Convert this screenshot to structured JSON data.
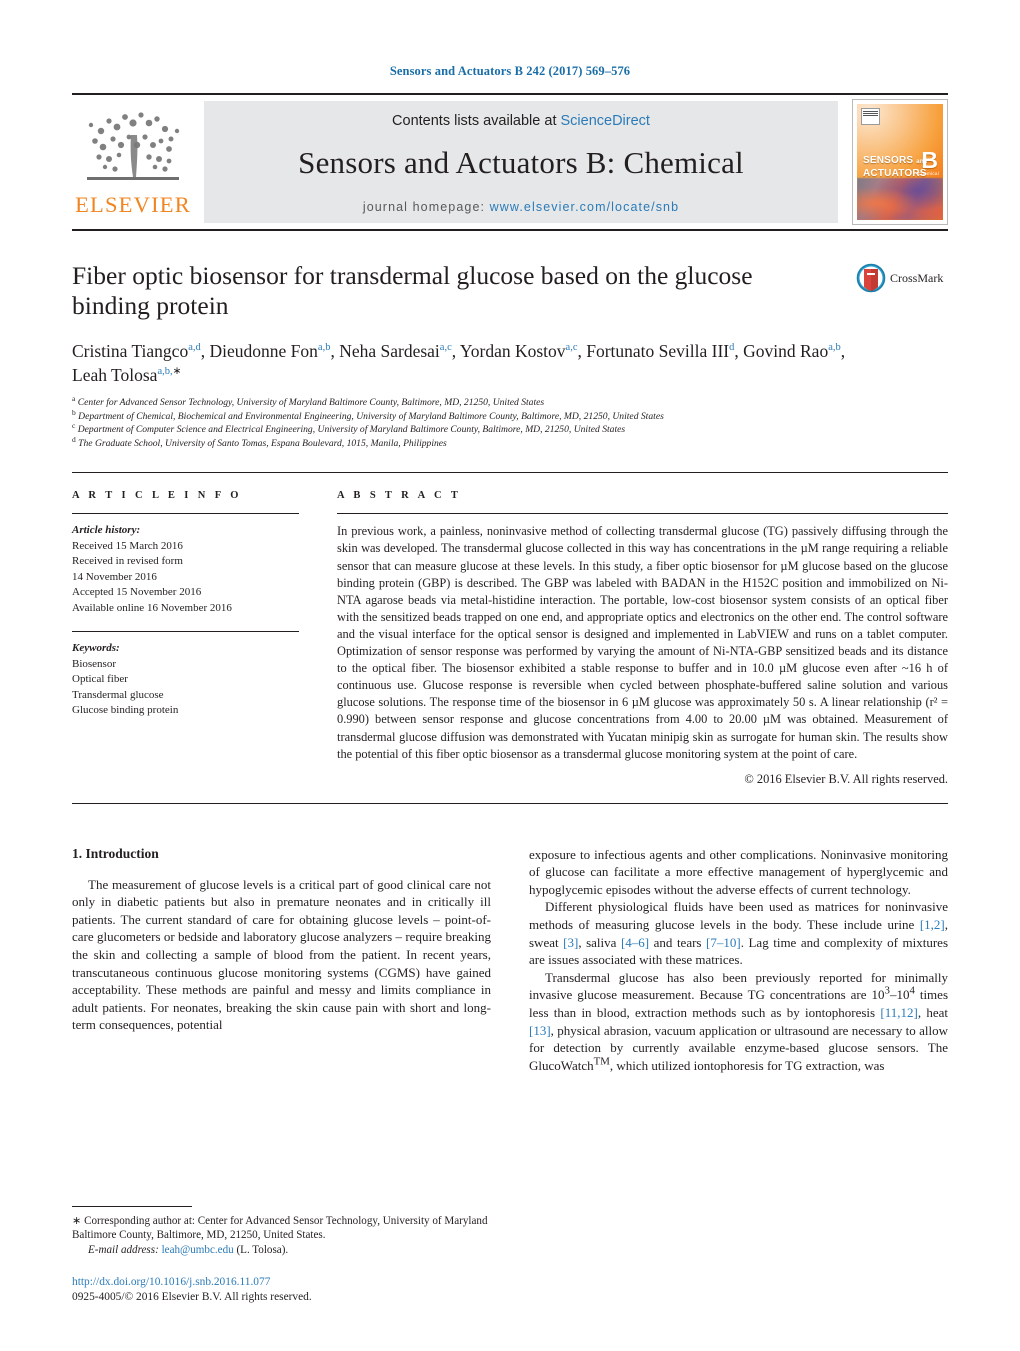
{
  "running_head": "Sensors and Actuators B 242 (2017) 569–576",
  "masthead": {
    "publisher_logo_text": "ELSEVIER",
    "contents_prefix": "Contents lists available at ",
    "contents_link": "ScienceDirect",
    "journal_title": "Sensors and Actuators B: Chemical",
    "homepage_prefix": "journal homepage: ",
    "homepage_url": "www.elsevier.com/locate/snb",
    "cover": {
      "line1": "SENSORS",
      "line1_suffix": "and",
      "line2": "ACTUATORS",
      "volume_letter": "B",
      "volume_sub": "Chemical"
    }
  },
  "article": {
    "title": "Fiber optic biosensor for transdermal glucose based on the glucose binding protein",
    "crossmark_label": "CrossMark",
    "authors": [
      {
        "name": "Cristina Tiangco",
        "marks": "a,d",
        "sep": ", "
      },
      {
        "name": "Dieudonne Fon",
        "marks": "a,b",
        "sep": ", "
      },
      {
        "name": "Neha Sardesai",
        "marks": "a,c",
        "sep": ", "
      },
      {
        "name": "Yordan Kostov",
        "marks": "a,c",
        "sep": ", "
      },
      {
        "name": "Fortunato Sevilla III",
        "marks": "d",
        "sep": ", "
      },
      {
        "name": "Govind Rao",
        "marks": "a,b",
        "sep": ", "
      },
      {
        "name": "Leah Tolosa",
        "marks": "a,b,",
        "star": "∗",
        "sep": ""
      }
    ],
    "affiliations": [
      {
        "mark": "a",
        "text": "Center for Advanced Sensor Technology, University of Maryland Baltimore County, Baltimore, MD, 21250, United States"
      },
      {
        "mark": "b",
        "text": "Department of Chemical, Biochemical and Environmental Engineering, University of Maryland Baltimore County, Baltimore, MD, 21250, United States"
      },
      {
        "mark": "c",
        "text": "Department of Computer Science and Electrical Engineering, University of Maryland Baltimore County, Baltimore, MD, 21250, United States"
      },
      {
        "mark": "d",
        "text": "The Graduate School, University of Santo Tomas, Espana Boulevard, 1015, Manila, Philippines"
      }
    ]
  },
  "article_info": {
    "kicker": "A R T I C L E   I N F O",
    "history_label": "Article history:",
    "history": [
      "Received 15 March 2016",
      "Received in revised form",
      "14 November 2016",
      "Accepted 15 November 2016",
      "Available online 16 November 2016"
    ],
    "keywords_label": "Keywords:",
    "keywords": [
      "Biosensor",
      "Optical fiber",
      "Transdermal glucose",
      "Glucose binding protein"
    ]
  },
  "abstract": {
    "kicker": "A B S T R A C T",
    "text": "In previous work, a painless, noninvasive method of collecting transdermal glucose (TG) passively diffusing through the skin was developed. The transdermal glucose collected in this way has concentrations in the µM range requiring a reliable sensor that can measure glucose at these levels. In this study, a fiber optic biosensor for µM glucose based on the glucose binding protein (GBP) is described. The GBP was labeled with BADAN in the H152C position and immobilized on Ni-NTA agarose beads via metal-histidine interaction. The portable, low-cost biosensor system consists of an optical fiber with the sensitized beads trapped on one end, and appropriate optics and electronics on the other end. The control software and the visual interface for the optical sensor is designed and implemented in LabVIEW and runs on a tablet computer. Optimization of sensor response was performed by varying the amount of Ni-NTA-GBP sensitized beads and its distance to the optical fiber. The biosensor exhibited a stable response to buffer and in 10.0 µM glucose even after ~16 h of continuous use. Glucose response is reversible when cycled between phosphate-buffered saline solution and various glucose solutions. The response time of the biosensor in 6 µM glucose was approximately 50 s. A linear relationship (r² = 0.990) between sensor response and glucose concentrations from 4.00 to 20.00 µM was obtained. Measurement of transdermal glucose diffusion was demonstrated with Yucatan minipig skin as surrogate for human skin. The results show the potential of this fiber optic biosensor as a transdermal glucose monitoring system at the point of care.",
    "copyright": "© 2016 Elsevier B.V. All rights reserved."
  },
  "body": {
    "section_number_title": "1.  Introduction",
    "left_paragraphs": [
      "The measurement of glucose levels is a critical part of good clinical care not only in diabetic patients but also in premature neonates and in critically ill patients. The current standard of care for obtaining glucose levels – point-of-care glucometers or bedside and laboratory glucose analyzers – require breaking the skin and collecting a sample of blood from the patient. In recent years, transcutaneous continuous glucose monitoring systems (CGMS) have gained acceptability. These methods are painful and messy and limits compliance in adult patients. For neonates, breaking the skin cause pain with short and long-term consequences, potential"
    ],
    "right_paragraphs": [
      {
        "segments": [
          {
            "t": "exposure to infectious agents and other complications. Noninvasive monitoring of glucose can facilitate a more effective management of hyperglycemic and hypoglycemic episodes without the adverse effects of current technology."
          }
        ],
        "indent": false
      },
      {
        "segments": [
          {
            "t": "Different physiological fluids have been used as matrices for noninvasive methods of measuring glucose levels in the body. These include urine "
          },
          {
            "t": "[1,2]",
            "link": true
          },
          {
            "t": ", sweat "
          },
          {
            "t": "[3]",
            "link": true
          },
          {
            "t": ", saliva "
          },
          {
            "t": "[4–6]",
            "link": true
          },
          {
            "t": " and tears "
          },
          {
            "t": "[7–10]",
            "link": true
          },
          {
            "t": ". Lag time and complexity of mixtures are issues associated with these matrices."
          }
        ],
        "indent": true
      },
      {
        "segments": [
          {
            "t": "Transdermal glucose has also been previously reported for minimally invasive glucose measurement. Because TG concentrations are 10"
          },
          {
            "t": "3",
            "sup": true
          },
          {
            "t": "–10"
          },
          {
            "t": "4",
            "sup": true
          },
          {
            "t": " times less than in blood, extraction methods such as by iontophoresis "
          },
          {
            "t": "[11,12]",
            "link": true
          },
          {
            "t": ", heat "
          },
          {
            "t": "[13]",
            "link": true
          },
          {
            "t": ", physical abrasion, vacuum application or ultrasound are necessary to allow for detection by currently available enzyme-based glucose sensors. The GlucoWatch"
          },
          {
            "t": "TM",
            "sup": true
          },
          {
            "t": ", which utilized iontophoresis for TG extraction, was"
          }
        ],
        "indent": true
      }
    ]
  },
  "footnote": {
    "corresponding_star": "∗",
    "corresponding_text": " Corresponding author at: Center for Advanced Sensor Technology, University of Maryland Baltimore County, Baltimore, MD, 21250, United States.",
    "email_label": "E-mail address:",
    "email": "leah@umbc.edu",
    "email_owner": "(L. Tolosa).",
    "doi": "http://dx.doi.org/10.1016/j.snb.2016.11.077",
    "issn_copyright": "0925-4005/© 2016 Elsevier B.V. All rights reserved."
  },
  "colors": {
    "link": "#2b7bb9",
    "elsevier_orange": "#f08522",
    "band_gray": "#e6e7e8"
  }
}
